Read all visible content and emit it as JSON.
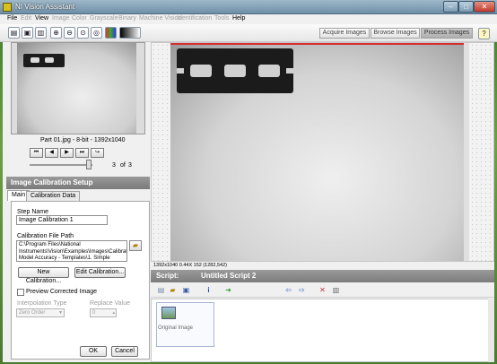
{
  "window": {
    "title": "NI Vision Assistant",
    "controls": [
      "–",
      "□",
      "✕"
    ]
  },
  "menubar": {
    "items": [
      {
        "label": "File",
        "enabled": true
      },
      {
        "label": "Edit",
        "enabled": false
      },
      {
        "label": "View",
        "enabled": true
      },
      {
        "label": "Image",
        "enabled": false
      },
      {
        "label": "Color",
        "enabled": false
      },
      {
        "label": "Grayscale",
        "enabled": false
      },
      {
        "label": "Binary",
        "enabled": false
      },
      {
        "label": "Machine Vision",
        "enabled": false
      },
      {
        "label": "Identification",
        "enabled": false
      },
      {
        "label": "Tools",
        "enabled": false
      },
      {
        "label": "Help",
        "enabled": true
      }
    ]
  },
  "toolbar": {
    "icons": [
      "open-icon",
      "save-icon",
      "print-icon",
      "zoom-in-icon",
      "zoom-out-icon",
      "zoom-fit-icon",
      "zoom-1to1-icon",
      "palette-icon",
      "gradient-icon"
    ],
    "mode_tabs": [
      "Acquire Images",
      "Browse Images",
      "Process Images"
    ],
    "active_tab": "Process Images",
    "help_icon": "?"
  },
  "thumbnail": {
    "caption": "Part 01.jpg - 8-bit - 1392x1040",
    "nav": [
      "⏮",
      "◀",
      "▶",
      "⏭",
      "↪"
    ],
    "page_current": "3",
    "page_of": "of",
    "page_total": "3",
    "slider_position": 0.9
  },
  "calibration": {
    "header": "Image Calibration Setup",
    "tabs": [
      "Main",
      "Calibration Data"
    ],
    "active_tab": "Main",
    "step_name_label": "Step Name",
    "step_name_value": "Image Calibration 1",
    "file_path_label": "Calibration File Path",
    "file_path_value": "C:\\Program Files\\National Instruments\\Vision\\Examples\\Images\\Calibration Model Accuracy - Templates\\1. Simple",
    "new_button": "New Calibration...",
    "edit_button": "Edit Calibration...",
    "preview_label": "Preview Corrected Image",
    "interp_label": "Interpolation Type",
    "interp_value": "Zero Order",
    "replace_label": "Replace Value",
    "replace_value": "0",
    "ok_button": "OK",
    "cancel_button": "Cancel"
  },
  "image_view": {
    "status": "1392x1040 0.44X 152    (1282,542)"
  },
  "script": {
    "label": "Script:",
    "name": "Untitled Script 2",
    "step_label": "Original Image"
  },
  "colors": {
    "accent_red": "#d43030",
    "header_gray": "#8a8a8a"
  }
}
